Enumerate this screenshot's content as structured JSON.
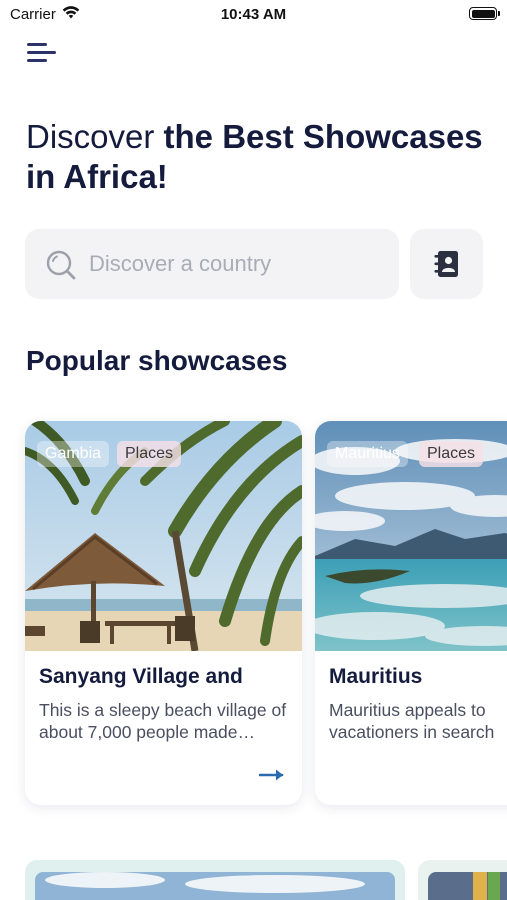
{
  "status_bar": {
    "carrier": "Carrier",
    "time": "10:43 AM"
  },
  "headline": {
    "light": "Discover ",
    "bold": "the Best Showcases in Africa!"
  },
  "search": {
    "placeholder": "Discover a country"
  },
  "section": {
    "title": "Popular showcases"
  },
  "cards": [
    {
      "country_tag": "Gambia",
      "category_tag": "Places",
      "title": "Sanyang Village and",
      "description": "This is a sleepy beach village of about 7,000 people made…"
    },
    {
      "country_tag": "Mauritius",
      "category_tag": "Places",
      "title": "Mauritius",
      "description_line1": "Mauritius appeals to",
      "description_line2": "vacationers in search"
    }
  ],
  "colors": {
    "heading": "#141b3d",
    "accent_arrow": "#2a6bb0",
    "menu_icon": "#2d3368",
    "search_bg": "#f3f3f5"
  },
  "icons": [
    "menu-icon",
    "search-icon",
    "contacts-book-icon",
    "arrow-right-icon"
  ]
}
